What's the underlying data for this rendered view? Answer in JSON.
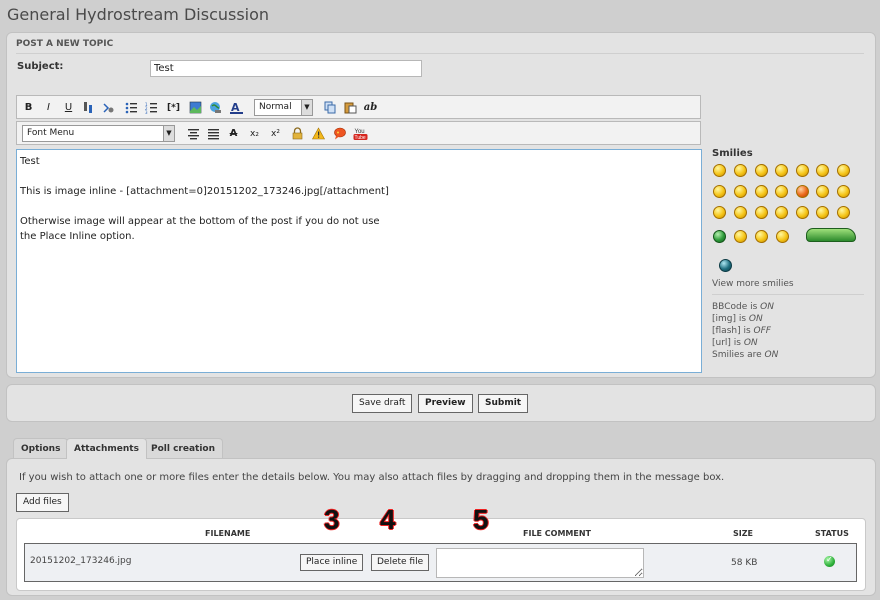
{
  "page": {
    "title": "General Hydrostream Discussion"
  },
  "post": {
    "heading": "POST A NEW TOPIC",
    "subject_label": "Subject:",
    "subject_value": "Test",
    "toolbar1": {
      "bold": "B",
      "italic": "I",
      "underline": "U",
      "font_size_value": "Normal",
      "spell_label": "ab"
    },
    "toolbar2": {
      "font_menu_value": "Font Menu",
      "subscript": "x₂",
      "superscript": "x²"
    },
    "editor_lines": [
      "Test",
      "This is image inline - [attachment=0]20151202_173246.jpg[/attachment]",
      "Otherwise image will appear at the bottom of the post if you do not use",
      "the Place Inline option."
    ]
  },
  "sidebar": {
    "smilies_title": "Smilies",
    "view_more": "View more smilies",
    "status": {
      "bbcode": "BBCode is ",
      "bbcode_val": "ON",
      "img": "[img] is ",
      "img_val": "ON",
      "flash": "[flash] is ",
      "flash_val": "OFF",
      "url": "[url] is ",
      "url_val": "ON",
      "smilies": "Smilies are ",
      "smilies_val": "ON"
    }
  },
  "actions": {
    "save_draft": "Save draft",
    "preview": "Preview",
    "submit": "Submit"
  },
  "tabs": {
    "options": "Options",
    "attachments": "Attachments",
    "poll": "Poll creation"
  },
  "attachments": {
    "info": "If you wish to attach one or more files enter the details below. You may also attach files by dragging and dropping them in the message box.",
    "add_files": "Add files",
    "headers": {
      "filename": "FILENAME",
      "comment": "FILE COMMENT",
      "size": "SIZE",
      "status": "STATUS"
    },
    "file": {
      "name": "20151202_173246.jpg",
      "place_inline": "Place inline",
      "delete": "Delete file",
      "size": "58 KB"
    }
  },
  "annotations": {
    "n3": "3",
    "n4": "4",
    "n5": "5"
  }
}
